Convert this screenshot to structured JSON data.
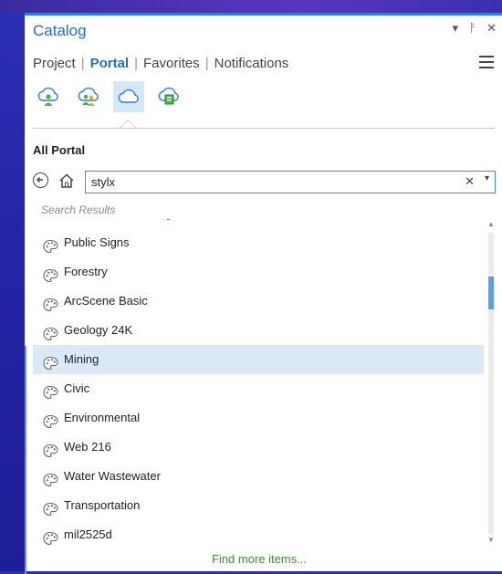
{
  "panel": {
    "title": "Catalog",
    "controls": {
      "dropdown": "▾",
      "pin": "ᚹ",
      "close": "✕"
    }
  },
  "tabs": [
    {
      "label": "Project",
      "active": false
    },
    {
      "label": "Portal",
      "active": true
    },
    {
      "label": "Favorites",
      "active": false
    },
    {
      "label": "Notifications",
      "active": false
    }
  ],
  "portal_icons": [
    "my-content-icon",
    "groups-icon",
    "all-portal-icon",
    "living-atlas-icon"
  ],
  "section_title": "All Portal",
  "search": {
    "value": "stylx",
    "placeholder": ""
  },
  "results_label": "Search Results",
  "items": [
    {
      "label": "Public Signs",
      "icon": "style-palette-icon",
      "selected": false
    },
    {
      "label": "Forestry",
      "icon": "style-palette-icon",
      "selected": false
    },
    {
      "label": "ArcScene Basic",
      "icon": "style-palette-icon",
      "selected": false
    },
    {
      "label": "Geology 24K",
      "icon": "style-palette-icon",
      "selected": false
    },
    {
      "label": "Mining",
      "icon": "style-palette-icon",
      "selected": true
    },
    {
      "label": "Civic",
      "icon": "style-palette-icon",
      "selected": false
    },
    {
      "label": "Environmental",
      "icon": "style-palette-icon",
      "selected": false
    },
    {
      "label": "Web 216",
      "icon": "style-palette-icon",
      "selected": false
    },
    {
      "label": "Water Wastewater",
      "icon": "style-palette-icon",
      "selected": false
    },
    {
      "label": "Transportation",
      "icon": "style-palette-icon",
      "selected": false
    },
    {
      "label": "mil2525d",
      "icon": "style-palette-icon",
      "selected": false
    }
  ],
  "find_more": "Find more items...",
  "colors": {
    "accent": "#1f6fc5",
    "selection": "#dbe9f7",
    "link_green": "#3f8b3a",
    "thumb": "#5aa0e4"
  }
}
